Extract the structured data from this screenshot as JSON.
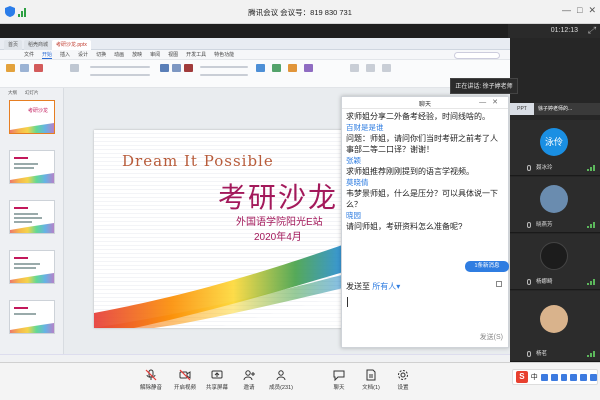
{
  "meeting": {
    "title": "腾讯会议 会议号：819 830 731",
    "timer": "01:12:13"
  },
  "wps": {
    "tabs": [
      "首页",
      "稻壳商城",
      "考研沙龙.pptx"
    ],
    "menu": [
      "文件",
      "开始",
      "插入",
      "设计",
      "切换",
      "动画",
      "放映",
      "审阅",
      "视图",
      "开发工具",
      "特色功能"
    ],
    "selected_menu": "开始",
    "thumb_tabs": [
      "大纲",
      "幻灯片"
    ],
    "thumbnails": [
      {
        "num": "1",
        "title": "考研沙龙"
      },
      {
        "num": "2",
        "title": ""
      },
      {
        "num": "3",
        "title": ""
      },
      {
        "num": "4",
        "title": ""
      },
      {
        "num": "5",
        "title": ""
      }
    ],
    "slide": {
      "headline": "Dream It Possible",
      "title": "考研沙龙",
      "subtitle": "外国语学院阳光E站",
      "date": "2020年4月"
    }
  },
  "chat": {
    "title": "聊天",
    "messages": [
      {
        "type": "text",
        "text": "求师姐分享二外备考经验，时间线啥的。"
      },
      {
        "type": "sender",
        "text": "百财是是谁"
      },
      {
        "type": "text",
        "text": "问题：师姐，请问你们当时考研之前考了人事部二等二口译？谢谢！"
      },
      {
        "type": "sender",
        "text": "张颖"
      },
      {
        "type": "text",
        "text": "求师姐推荐刚刚提到的语言学视频。"
      },
      {
        "type": "sender",
        "text": "莫晓倩"
      },
      {
        "type": "text",
        "text": "韦梦景师姐，什么是压分？可以具体说一下么？"
      },
      {
        "type": "sender",
        "text": "晓园"
      },
      {
        "type": "text",
        "text": "请问师姐，考研资料怎么准备呢?"
      }
    ],
    "new_messages": "1条新消息",
    "send_to_label": "发送至",
    "send_to_target": "所有人",
    "send_button": "发送(S)"
  },
  "gallery": {
    "speaking": "正在讲话: 徐子婷老师",
    "mini_tab": "PPT",
    "top_label": "徐子婷老师的...",
    "tiles": [
      {
        "name": "聂冰玲",
        "avatar_text": "泳伶",
        "color": "#1a8fe3"
      },
      {
        "name": "晓燕芳",
        "avatar_text": "",
        "color": "#6a8caf"
      },
      {
        "name": "杨娜畸",
        "avatar_text": "",
        "color": "#2c2c2c"
      },
      {
        "name": "杨茗",
        "avatar_text": "",
        "color": "#d9b38c"
      }
    ]
  },
  "toolbar": {
    "items": [
      {
        "label": "解除静音",
        "name": "unmute"
      },
      {
        "label": "开启视频",
        "name": "start-video"
      },
      {
        "label": "共享屏幕",
        "name": "share-screen"
      },
      {
        "label": "邀请",
        "name": "invite"
      },
      {
        "label": "成员(231)",
        "name": "members"
      },
      {
        "label": "聊天",
        "name": "chat"
      },
      {
        "label": "文档(1)",
        "name": "documents"
      },
      {
        "label": "设置",
        "name": "settings"
      }
    ]
  },
  "ime": {
    "badge": "S",
    "text": "中"
  }
}
